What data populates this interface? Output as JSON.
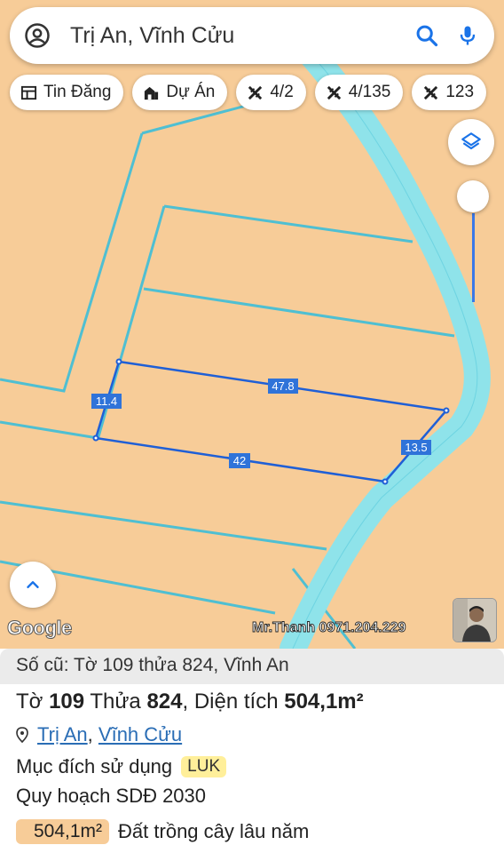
{
  "search": {
    "query": "Trị An, Vĩnh Cửu"
  },
  "chips": [
    {
      "label": "Tin Đăng",
      "icon": "listing-icon"
    },
    {
      "label": "Dự Án",
      "icon": "project-icon"
    },
    {
      "label": "4/2",
      "icon": "planning-icon"
    },
    {
      "label": "4/135",
      "icon": "planning-icon"
    },
    {
      "label": "123",
      "icon": "planning-icon"
    }
  ],
  "map": {
    "dimension_labels": [
      "47.8",
      "11.4",
      "13.5",
      "42"
    ],
    "logo": "Google",
    "watermark": "Mr.Thanh 0971.204.229",
    "colors": {
      "land": "#f7cc98",
      "river": "#8fe3ea",
      "parcel_outline": "#1f5fd6",
      "boundary": "#4fbfd2"
    }
  },
  "info": {
    "old_ref": "Số cũ: Tờ 109 thửa 824, Vĩnh An",
    "sheet_label": "Tờ",
    "sheet_no": "109",
    "parcel_label": "Thửa",
    "parcel_no": "824",
    "area_label": "Diện tích",
    "area_value": "504,1m²",
    "comma": ",",
    "location_ward": "Trị An",
    "location_district": "Vĩnh Cửu",
    "purpose_label": "Mục đích sử dụng",
    "purpose_code": "LUK",
    "plan_label": "Quy hoạch SDĐ 2030",
    "plan_area": "504,1m²",
    "plan_type": "Đất trồng cây lâu năm"
  }
}
